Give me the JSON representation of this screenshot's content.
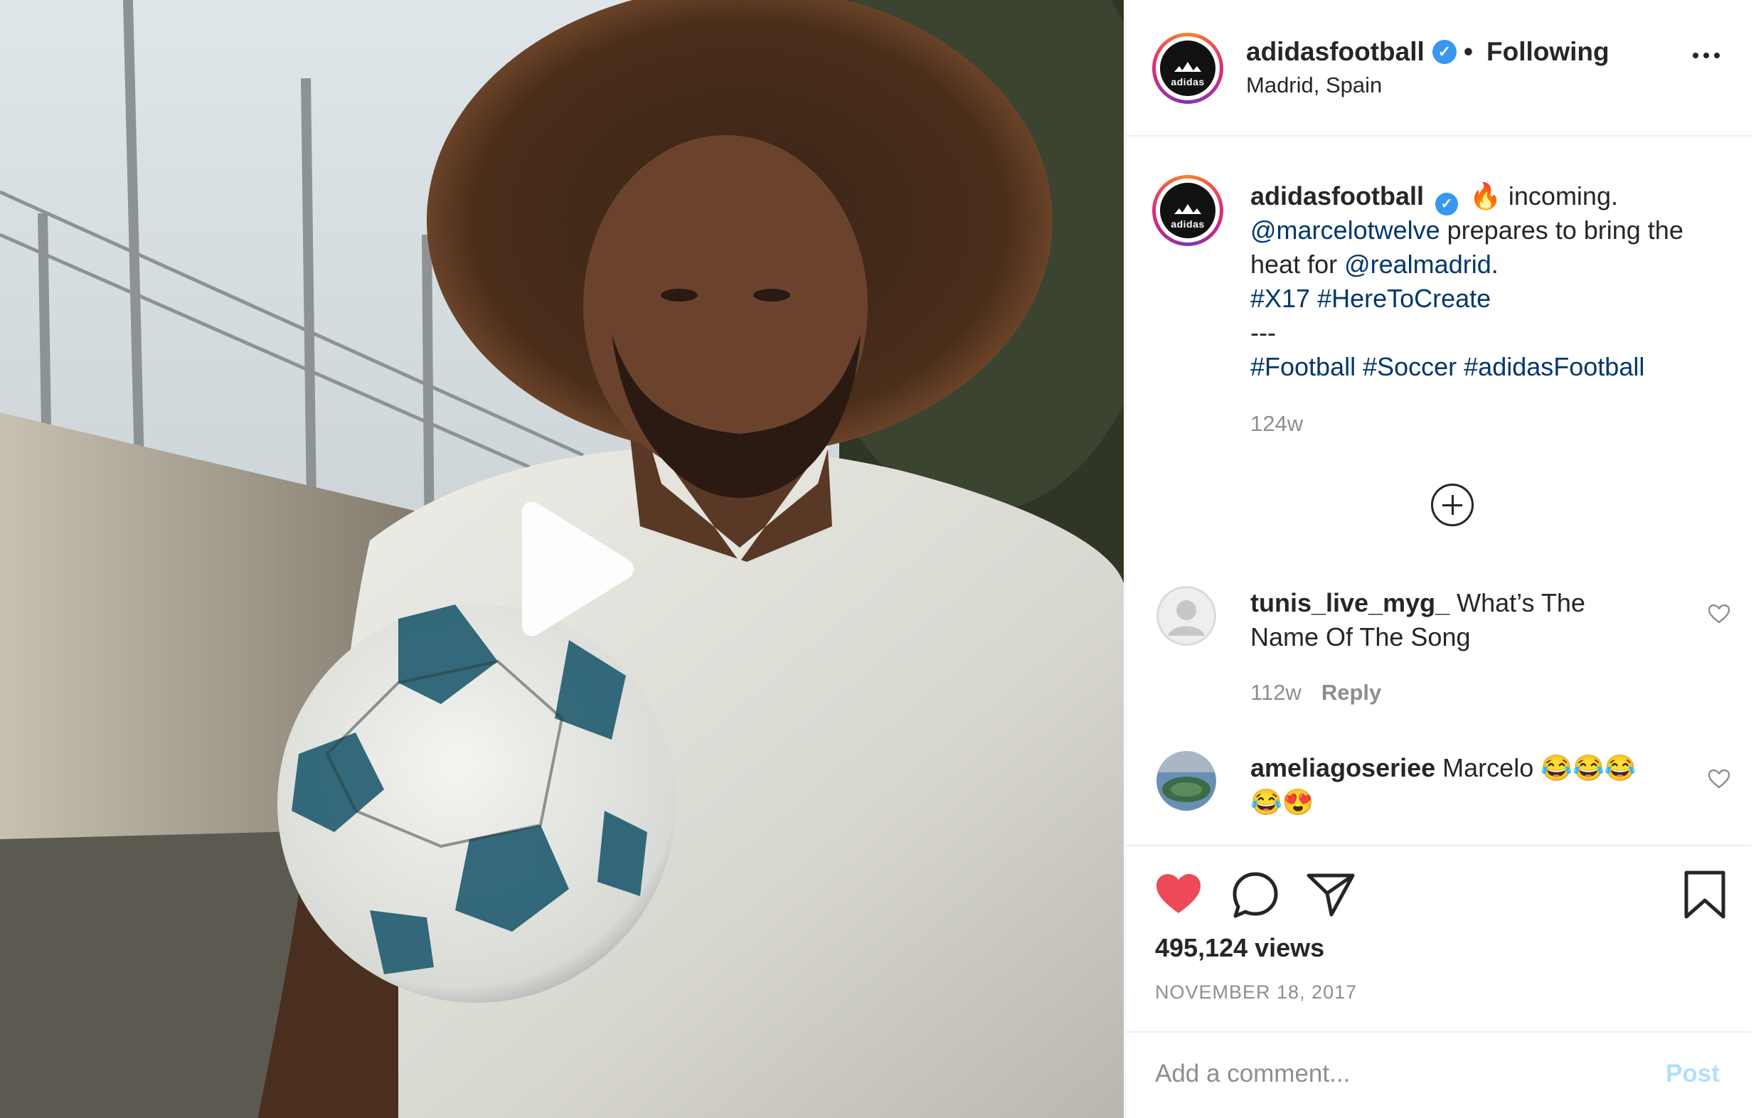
{
  "post": {
    "media_alt": "video",
    "header": {
      "username": "adidasfootball",
      "verified_mark": "✓",
      "separator": "•",
      "follow_status": "Following",
      "location": "Madrid, Spain",
      "avatar_text": "adidas"
    },
    "caption": {
      "username": "adidasfootball",
      "emoji": "🔥",
      "text_start": "incoming.",
      "mention_1": "@marcelotwelve",
      "text_mid": "prepares to bring the",
      "text_heat": "heat for",
      "mention_2": "@realmadrid",
      "period": ".",
      "hashtags_1": "#X17 #HereToCreate",
      "separator": "---",
      "hashtags_2": "#Football #Soccer #adidasFootball",
      "age": "124w"
    },
    "comments": [
      {
        "username": "tunis_live_myg_",
        "text": "What’s The Name Of The Song",
        "age": "112w",
        "reply_label": "Reply"
      },
      {
        "username": "ameliagoseriee",
        "text": "Marcelo 😂😂😂 😂😍"
      }
    ],
    "views": "495,124 views",
    "date": "NOVEMBER 18, 2017",
    "comment_placeholder": "Add a comment...",
    "post_label": "Post",
    "icons": {
      "more": "more-options-icon",
      "like": "heart-icon",
      "comment": "comment-icon",
      "share": "share-icon",
      "save": "bookmark-icon",
      "load_more": "plus-circle-icon",
      "play": "play-icon"
    }
  },
  "colors": {
    "link": "#00376b",
    "like": "#ed4956",
    "verified": "#3897f0",
    "muted": "#8e8e8e",
    "post_disabled": "#b2dffc"
  }
}
